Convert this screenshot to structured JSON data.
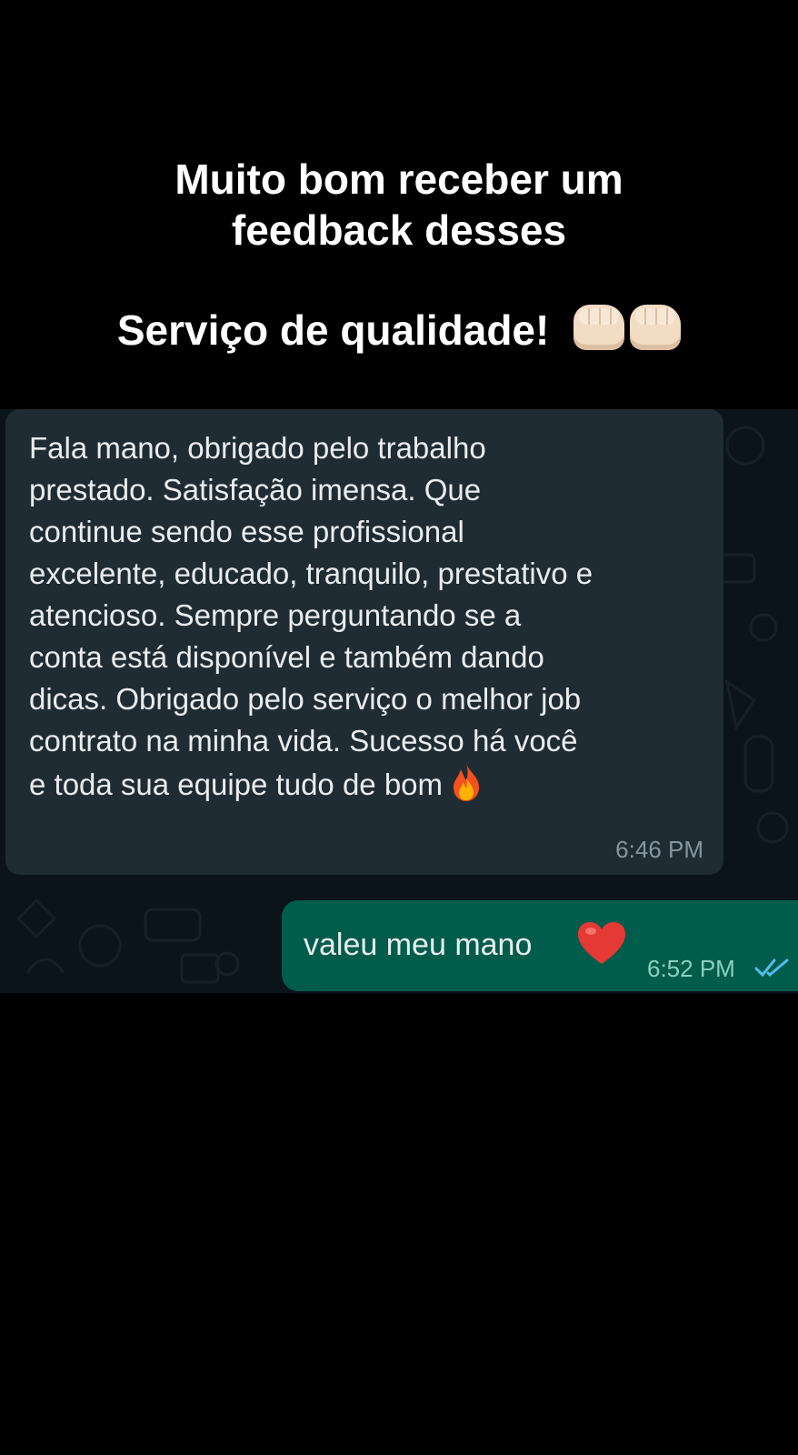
{
  "caption": {
    "line1": "Muito bom receber um",
    "line2": "feedback desses",
    "line3": "Serviço de qualidade!",
    "emoji_icon": "fist-bump-icon"
  },
  "chat": {
    "incoming": {
      "text": "Fala mano, obrigado pelo trabalho\nprestado. Satisfação imensa. Que\ncontinue sendo esse profissional\nexcelente, educado, tranquilo, prestativo e\natencioso. Sempre perguntando se a\nconta está disponível e também dando\ndicas. Obrigado pelo serviço o melhor job\ncontrato na minha vida. Sucesso há você\ne toda sua equipe tudo de bom",
      "emoji_icon": "fire-icon",
      "time": "6:46 PM"
    },
    "outgoing": {
      "text": "valeu meu mano",
      "emoji_icon": "heart-icon",
      "time": "6:52 PM",
      "status_icon": "double-check-icon"
    }
  },
  "colors": {
    "background": "#000000",
    "chat_background": "#0b141a",
    "incoming_bubble": "#202c33",
    "outgoing_bubble": "#005c4b",
    "read_ticks": "#53bdeb"
  }
}
